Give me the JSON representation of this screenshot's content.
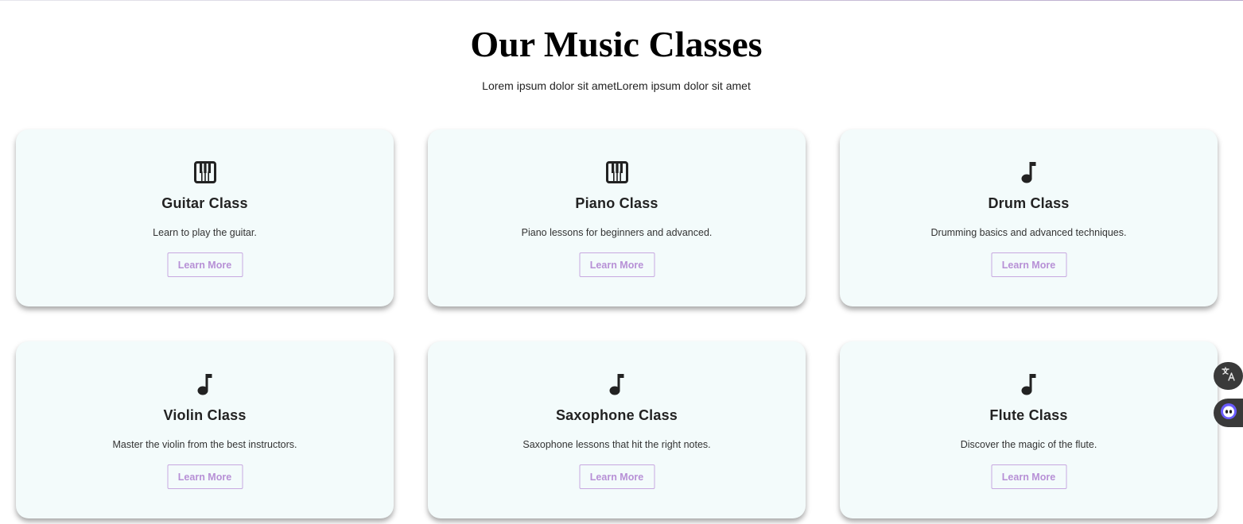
{
  "header": {
    "title": "Our Music Classes",
    "subtitle": "Lorem ipsum dolor sit ametLorem ipsum dolor sit amet"
  },
  "colors": {
    "card_background": "#f3fbfb",
    "button_border": "#c7a8e0",
    "button_text": "#b790d6",
    "icon": "#222222"
  },
  "classes": [
    {
      "icon": "piano-keys-icon",
      "title": "Guitar Class",
      "description": "Learn to play the guitar.",
      "button_label": "Learn More"
    },
    {
      "icon": "piano-keys-icon",
      "title": "Piano Class",
      "description": "Piano lessons for beginners and advanced.",
      "button_label": "Learn More"
    },
    {
      "icon": "music-note-icon",
      "title": "Drum Class",
      "description": "Drumming basics and advanced techniques.",
      "button_label": "Learn More"
    },
    {
      "icon": "music-note-icon",
      "title": "Violin Class",
      "description": "Master the violin from the best instructors.",
      "button_label": "Learn More"
    },
    {
      "icon": "music-note-icon",
      "title": "Saxophone Class",
      "description": "Saxophone lessons that hit the right notes.",
      "button_label": "Learn More"
    },
    {
      "icon": "music-note-icon",
      "title": "Flute Class",
      "description": "Discover the magic of the flute.",
      "button_label": "Learn More"
    }
  ],
  "side_widgets": [
    {
      "icon": "translate-icon"
    },
    {
      "icon": "assistant-icon"
    }
  ]
}
